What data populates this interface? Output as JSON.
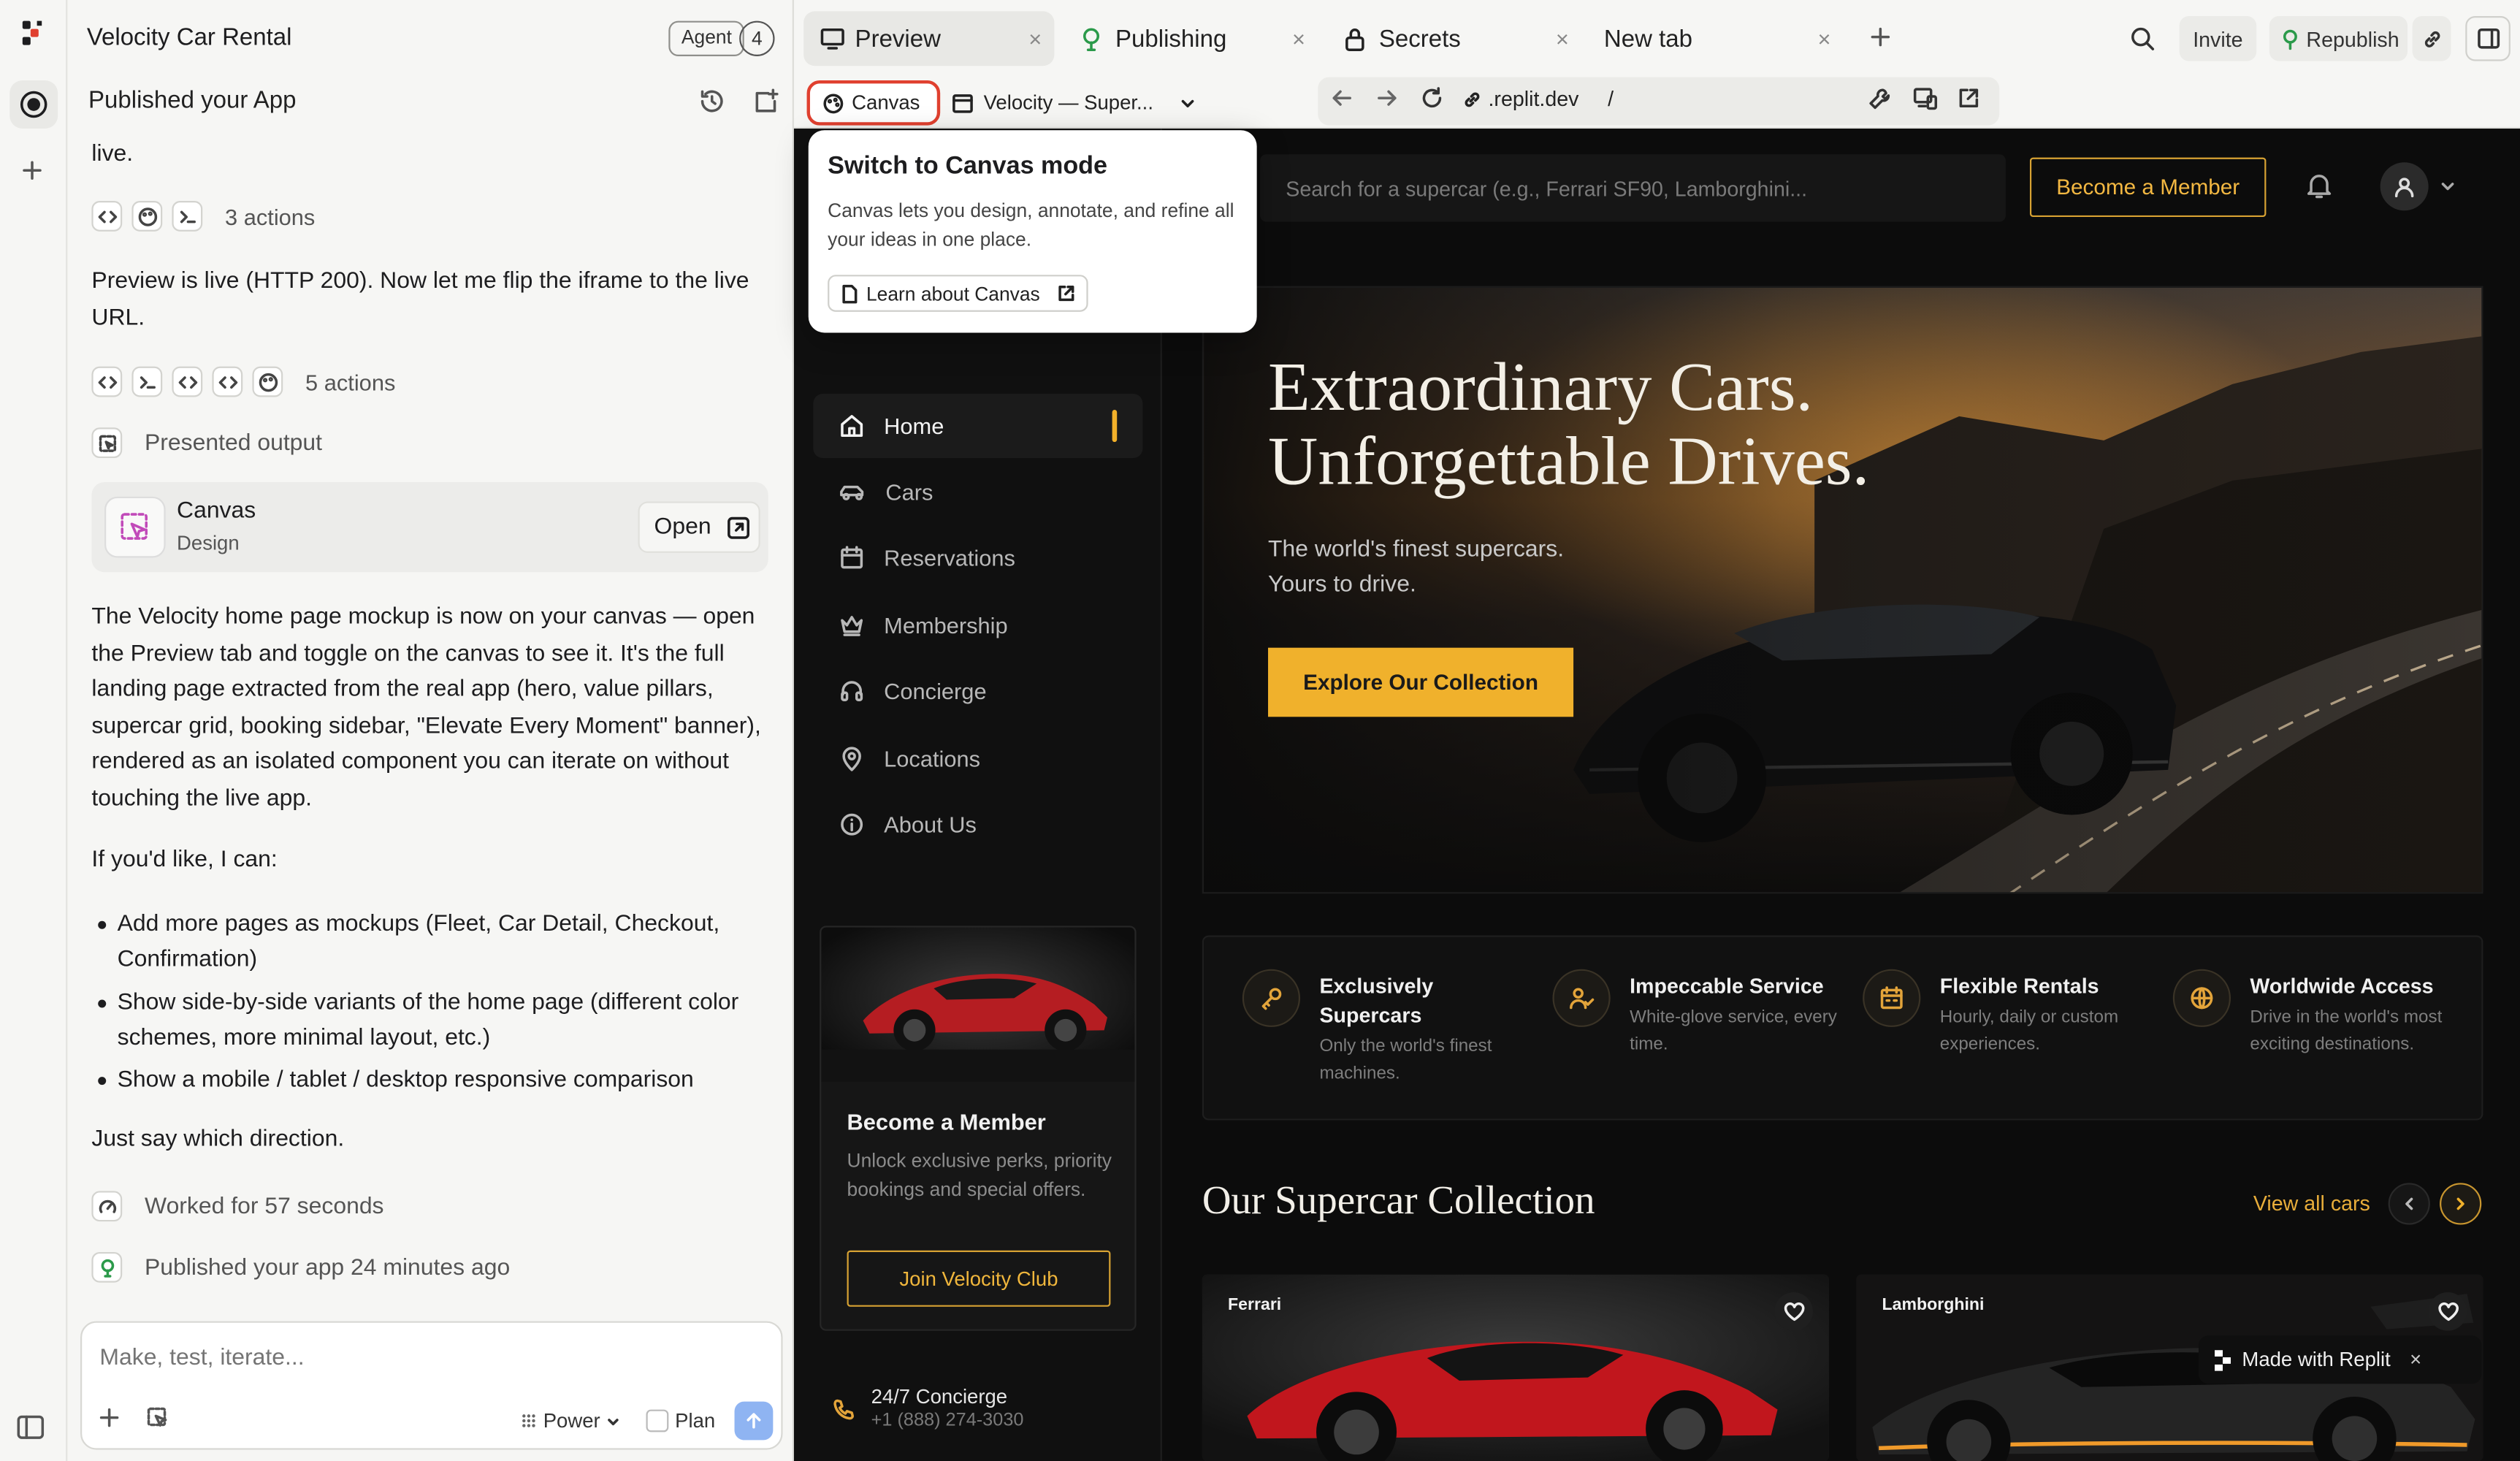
{
  "workspace": {
    "project_title": "Velocity Car Rental",
    "agent_label": "Agent",
    "agent_count": "4",
    "chat_header": "Published your App"
  },
  "chat": {
    "top_fragment": "live.",
    "actions_1": "3 actions",
    "message_1": "Preview is live (HTTP 200). Now let me flip the iframe to the live URL.",
    "actions_2": "5 actions",
    "presented_output": "Presented output",
    "canvas_card": {
      "title": "Canvas",
      "subtitle": "Design",
      "open_label": "Open"
    },
    "message_2": "The Velocity home page mockup is now on your canvas — open the Preview tab and toggle on the canvas to see it. It's the full landing page extracted from the real app (hero, value pillars, supercar grid, booking sidebar, \"Elevate Every Moment\" banner), rendered as an isolated component you can iterate on without touching the live app.",
    "message_3": "If you'd like, I can:",
    "bullets": [
      "Add more pages as mockups (Fleet, Car Detail, Checkout, Confirmation)",
      "Show side-by-side variants of the home page (different color schemes, more minimal layout, etc.)",
      "Show a mobile / tablet / desktop responsive comparison"
    ],
    "message_4": "Just say which direction.",
    "worked_for": "Worked for 57 seconds",
    "published_note": "Published your app 24 minutes ago",
    "input_placeholder": "Make, test, iterate...",
    "mode_power": "Power",
    "mode_plan": "Plan"
  },
  "tabs": [
    {
      "label": "Preview"
    },
    {
      "label": "Publishing"
    },
    {
      "label": "Secrets"
    },
    {
      "label": "New tab"
    }
  ],
  "topbar": {
    "invite": "Invite",
    "republish": "Republish"
  },
  "browser": {
    "canvas_button": "Canvas",
    "page_select": "Velocity — Super...",
    "url": ".replit.dev",
    "path": "/"
  },
  "popover": {
    "title": "Switch to Canvas mode",
    "body": "Canvas lets you design, annotate, and refine all your ideas in one place.",
    "link": "Learn about Canvas"
  },
  "site": {
    "nav": [
      "Home",
      "Cars",
      "Reservations",
      "Membership",
      "Concierge",
      "Locations",
      "About Us"
    ],
    "search_placeholder": "Search for a supercar (e.g., Ferrari SF90, Lamborghini...",
    "become_member": "Become a Member",
    "hero": {
      "line1": "Extraordinary Cars.",
      "line2": "Unforgettable Drives.",
      "sub1": "The world's finest supercars.",
      "sub2": "Yours to drive.",
      "cta": "Explore Our Collection"
    },
    "pillars": [
      {
        "title": "Exclusively Supercars",
        "desc": "Only the world's finest machines."
      },
      {
        "title": "Impeccable Service",
        "desc": "White-glove service, every time."
      },
      {
        "title": "Flexible Rentals",
        "desc": "Hourly, daily or custom experiences."
      },
      {
        "title": "Worldwide Access",
        "desc": "Drive in the world's most exciting destinations."
      }
    ],
    "collection_title": "Our Supercar Collection",
    "view_all": "View all cars",
    "cars": [
      "Ferrari",
      "Lamborghini"
    ],
    "member_card": {
      "title": "Become a Member",
      "body": "Unlock exclusive perks, priority bookings and special offers.",
      "button": "Join Velocity Club"
    },
    "concierge_title": "24/7 Concierge",
    "concierge_phone": "+1 (888) 274-3030",
    "made_with": "Made with Replit"
  },
  "colors": {
    "accent_gold": "#f0b12c",
    "canvas_highlight": "#e0402f",
    "send_blue": "#8fb4f2"
  }
}
